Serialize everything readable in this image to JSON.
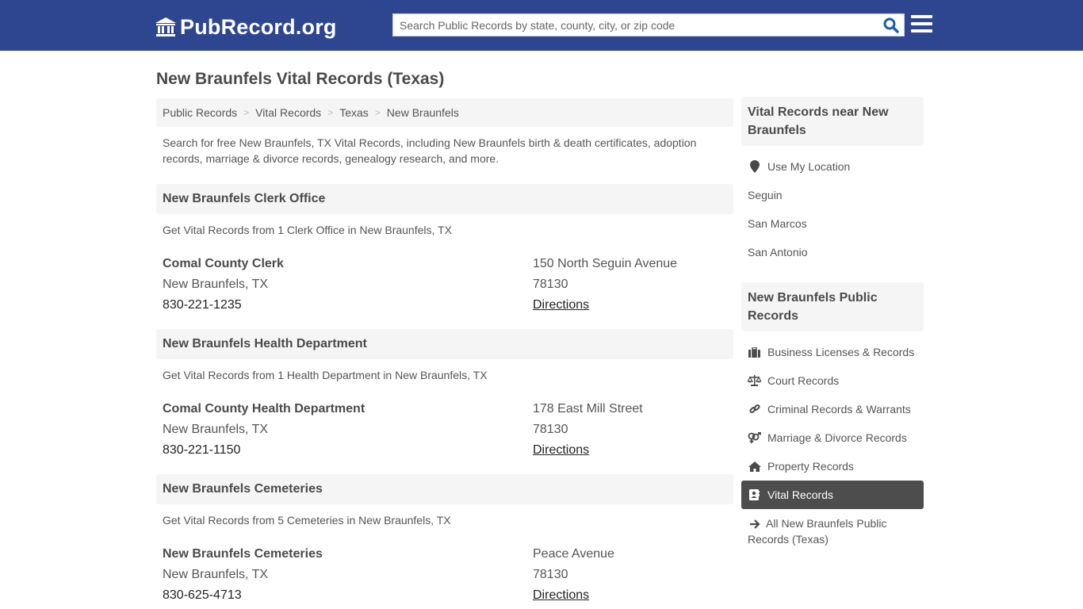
{
  "header": {
    "logo_text": "PubRecord.org",
    "logo_icon": "courthouse-icon",
    "search_placeholder": "Search Public Records by state, county, city, or zip code",
    "search_value": "",
    "search_icon": "search-icon",
    "menu_icon": "hamburger-menu-icon",
    "brand_color": "#2e4690",
    "accent_color": "#1a5fa8"
  },
  "page_title": "New Braunfels Vital Records (Texas)",
  "breadcrumb": [
    "Public Records",
    "Vital Records",
    "Texas",
    "New Braunfels"
  ],
  "breadcrumb_separator": ">",
  "intro": "Search for free New Braunfels, TX Vital Records, including New Braunfels birth & death certificates, adoption records, marriage & divorce records, genealogy research, and more.",
  "sections": [
    {
      "title": "New Braunfels Clerk Office",
      "description": "Get Vital Records from 1 Clerk Office in New Braunfels, TX",
      "entries": [
        {
          "name": "Comal County Clerk",
          "city": "New Braunfels, TX",
          "phone": "830-221-1235",
          "address": "150 North Seguin Avenue",
          "zip": "78130",
          "directions_label": "Directions"
        }
      ]
    },
    {
      "title": "New Braunfels Health Department",
      "description": "Get Vital Records from 1 Health Department in New Braunfels, TX",
      "entries": [
        {
          "name": "Comal County Health Department",
          "city": "New Braunfels, TX",
          "phone": "830-221-1150",
          "address": "178 East Mill Street",
          "zip": "78130",
          "directions_label": "Directions"
        }
      ]
    },
    {
      "title": "New Braunfels Cemeteries",
      "description": "Get Vital Records from 5 Cemeteries in New Braunfels, TX",
      "entries": [
        {
          "name": "New Braunfels Cemeteries",
          "city": "New Braunfels, TX",
          "phone": "830-625-4713",
          "address": "Peace Avenue",
          "zip": "78130",
          "directions_label": "Directions"
        }
      ]
    }
  ],
  "sidebar": {
    "nearby": {
      "title": "Vital Records near New Braunfels",
      "use_location": {
        "label": "Use My Location",
        "icon": "map-marker-icon"
      },
      "cities": [
        "Seguin",
        "San Marcos",
        "San Antonio"
      ]
    },
    "public_records": {
      "title": "New Braunfels Public Records",
      "items": [
        {
          "label": "Business Licenses & Records",
          "icon": "briefcase-icon",
          "active": false
        },
        {
          "label": "Court Records",
          "icon": "balance-scale-icon",
          "active": false
        },
        {
          "label": "Criminal Records & Warrants",
          "icon": "link-icon",
          "active": false
        },
        {
          "label": "Marriage & Divorce Records",
          "icon": "venus-mars-icon",
          "active": false
        },
        {
          "label": "Property Records",
          "icon": "home-icon",
          "active": false
        },
        {
          "label": "Vital Records",
          "icon": "address-book-icon",
          "active": true
        }
      ],
      "all_link": {
        "label": "All New Braunfels Public Records (Texas)",
        "icon": "arrow-right-icon"
      }
    }
  }
}
